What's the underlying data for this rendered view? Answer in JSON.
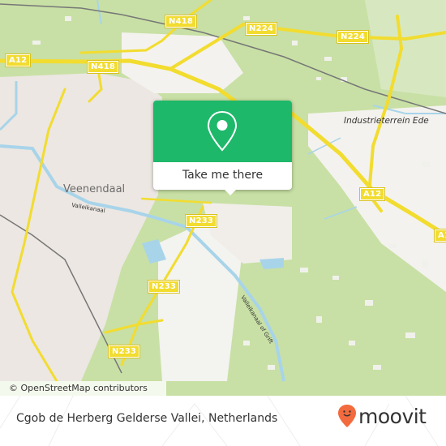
{
  "map": {
    "road_labels": [
      {
        "id": "n418-top",
        "text": "N418"
      },
      {
        "id": "n224-left",
        "text": "N224"
      },
      {
        "id": "n224-right",
        "text": "N224"
      },
      {
        "id": "a12-left",
        "text": "A12"
      },
      {
        "id": "n418-mid",
        "text": "N418"
      },
      {
        "id": "a12-right",
        "text": "A12"
      },
      {
        "id": "a12-edge",
        "text": "A1"
      },
      {
        "id": "n233-top",
        "text": "N233"
      },
      {
        "id": "n233-mid",
        "text": "N233"
      },
      {
        "id": "n233-bottom",
        "text": "N233"
      }
    ],
    "place_labels": {
      "veenendaal": "Veenendaal",
      "industrieterrein": "Industrieterrein Ede",
      "valleikanaal": "Valleikanaal",
      "valleikanaal_grift": "Valleikanaal of Grift"
    },
    "attribution": "© OpenStreetMap contributors",
    "colors": {
      "land_green": "#c8e0a5",
      "urban": "#ece7e2",
      "water": "#a8d4ea",
      "road": "#f2dc2f",
      "rail": "#777777"
    }
  },
  "popup": {
    "icon": "map-pin-icon",
    "button_label": "Take me there",
    "accent_color": "#1eb86a"
  },
  "footer": {
    "location_title": "Cgob de Herberg Gelderse Vallei, Netherlands",
    "brand_name": "moovit",
    "brand_icon": "moovit-pin-icon",
    "brand_color": "#f26a3d"
  }
}
